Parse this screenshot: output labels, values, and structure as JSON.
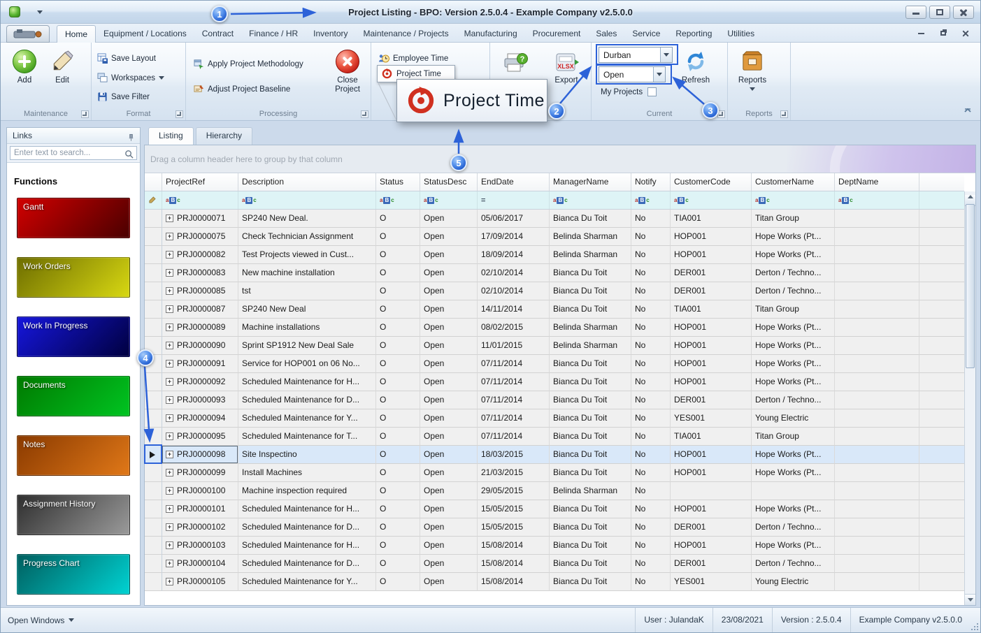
{
  "window": {
    "title": "Project Listing - BPO: Version 2.5.0.4 - Example Company v2.5.0.0"
  },
  "colors": {
    "annotation_blue": "#2d62d8",
    "selected_row": "#d9e8f9",
    "filter_row": "#def4f6"
  },
  "icons": [
    "app-logo-icon",
    "quick-access-dropdown-icon",
    "minimize-icon",
    "maximize-icon",
    "close-icon",
    "add-icon",
    "edit-icon",
    "save-layout-icon",
    "workspaces-icon",
    "save-filter-icon",
    "apply-methodology-icon",
    "adjust-baseline-icon",
    "close-project-icon",
    "employee-time-icon",
    "project-time-icon",
    "print-icon",
    "export-icon",
    "refresh-icon",
    "reports-icon",
    "pin-icon",
    "search-icon",
    "expand-icon",
    "row-marker-icon",
    "filter-abc-icon",
    "filter-equals-icon"
  ],
  "ribbon": {
    "tabs": [
      "Home",
      "Equipment / Locations",
      "Contract",
      "Finance / HR",
      "Inventory",
      "Maintenance / Projects",
      "Manufacturing",
      "Procurement",
      "Sales",
      "Service",
      "Reporting",
      "Utilities"
    ],
    "active_tab": "Home",
    "maintenance": {
      "label": "Maintenance",
      "add": "Add",
      "edit": "Edit"
    },
    "format": {
      "label": "Format",
      "save_layout": "Save Layout",
      "workspaces": "Workspaces",
      "save_filter": "Save Filter"
    },
    "processing": {
      "label": "Processing",
      "apply": "Apply Project Methodology",
      "adjust": "Adjust Project Baseline",
      "close_project": "Close Project"
    },
    "time": {
      "employee_time": "Employee Time",
      "project_time": "Project Time"
    },
    "export_label": "Export",
    "current": {
      "label": "Current",
      "site_value": "Durban",
      "status_value": "Open",
      "my_projects": "My Projects",
      "refresh": "Refresh"
    },
    "reports": {
      "label": "Reports",
      "button": "Reports"
    },
    "callout_text": "Project Time"
  },
  "sidebar": {
    "title": "Links",
    "search_placeholder": "Enter text to search...",
    "functions_header": "Functions",
    "functions": [
      {
        "label": "Gantt",
        "color_from": "#d10000",
        "color_to": "#4a0000"
      },
      {
        "label": "Work Orders",
        "color_from": "#6e6e00",
        "color_to": "#d8d812"
      },
      {
        "label": "Work In Progress",
        "color_from": "#1616dc",
        "color_to": "#00003f"
      },
      {
        "label": "Documents",
        "color_from": "#007a00",
        "color_to": "#00c421"
      },
      {
        "label": "Notes",
        "color_from": "#8a3a00",
        "color_to": "#e07818"
      },
      {
        "label": "Assignment History",
        "color_from": "#2f2f2f",
        "color_to": "#9a9a9a"
      },
      {
        "label": "Progress Chart",
        "color_from": "#005f5f",
        "color_to": "#00d2d2"
      }
    ]
  },
  "main": {
    "tabs": [
      "Listing",
      "Hierarchy"
    ],
    "active_tab": "Listing",
    "group_by_hint": "Drag a column header here to group by that column",
    "grid": {
      "columns": [
        "ProjectRef",
        "Description",
        "Status",
        "StatusDesc",
        "EndDate",
        "ManagerName",
        "Notify",
        "CustomerCode",
        "CustomerName",
        "DeptName"
      ],
      "filter_badge": "aBc",
      "filter_equals": "=",
      "expand_glyph": "+",
      "selected_index": 13,
      "rows": [
        [
          "PRJ0000071",
          "SP240 New Deal.",
          "O",
          "Open",
          "05/06/2017",
          "Bianca Du Toit",
          "No",
          "TIA001",
          "Titan Group",
          ""
        ],
        [
          "PRJ0000075",
          "Check Technician Assignment",
          "O",
          "Open",
          "17/09/2014",
          "Belinda Sharman",
          "No",
          "HOP001",
          "Hope Works (Pt...",
          ""
        ],
        [
          "PRJ0000082",
          "Test Projects viewed in Cust...",
          "O",
          "Open",
          "18/09/2014",
          "Belinda Sharman",
          "No",
          "HOP001",
          "Hope Works (Pt...",
          ""
        ],
        [
          "PRJ0000083",
          "New machine installation",
          "O",
          "Open",
          "02/10/2014",
          "Bianca Du Toit",
          "No",
          "DER001",
          "Derton / Techno...",
          ""
        ],
        [
          "PRJ0000085",
          "tst",
          "O",
          "Open",
          "02/10/2014",
          "Bianca Du Toit",
          "No",
          "DER001",
          "Derton / Techno...",
          ""
        ],
        [
          "PRJ0000087",
          "SP240 New Deal",
          "O",
          "Open",
          "14/11/2014",
          "Bianca Du Toit",
          "No",
          "TIA001",
          "Titan Group",
          ""
        ],
        [
          "PRJ0000089",
          "Machine installations",
          "O",
          "Open",
          "08/02/2015",
          "Belinda Sharman",
          "No",
          "HOP001",
          "Hope Works (Pt...",
          ""
        ],
        [
          "PRJ0000090",
          "Sprint SP1912 New Deal Sale",
          "O",
          "Open",
          "11/01/2015",
          "Belinda Sharman",
          "No",
          "HOP001",
          "Hope Works (Pt...",
          ""
        ],
        [
          "PRJ0000091",
          "Service for HOP001 on 06 No...",
          "O",
          "Open",
          "07/11/2014",
          "Bianca Du Toit",
          "No",
          "HOP001",
          "Hope Works (Pt...",
          ""
        ],
        [
          "PRJ0000092",
          "Scheduled Maintenance for H...",
          "O",
          "Open",
          "07/11/2014",
          "Bianca Du Toit",
          "No",
          "HOP001",
          "Hope Works (Pt...",
          ""
        ],
        [
          "PRJ0000093",
          "Scheduled Maintenance for D...",
          "O",
          "Open",
          "07/11/2014",
          "Bianca Du Toit",
          "No",
          "DER001",
          "Derton / Techno...",
          ""
        ],
        [
          "PRJ0000094",
          "Scheduled Maintenance for Y...",
          "O",
          "Open",
          "07/11/2014",
          "Bianca Du Toit",
          "No",
          "YES001",
          "Young Electric",
          ""
        ],
        [
          "PRJ0000095",
          "Scheduled Maintenance for T...",
          "O",
          "Open",
          "07/11/2014",
          "Bianca Du Toit",
          "No",
          "TIA001",
          "Titan Group",
          ""
        ],
        [
          "PRJ0000098",
          "Site Inspectino",
          "O",
          "Open",
          "18/03/2015",
          "Bianca Du Toit",
          "No",
          "HOP001",
          "Hope Works (Pt...",
          ""
        ],
        [
          "PRJ0000099",
          "Install Machines",
          "O",
          "Open",
          "21/03/2015",
          "Bianca Du Toit",
          "No",
          "HOP001",
          "Hope Works (Pt...",
          ""
        ],
        [
          "PRJ0000100",
          "Machine inspection required",
          "O",
          "Open",
          "29/05/2015",
          "Belinda Sharman",
          "No",
          "",
          "",
          ""
        ],
        [
          "PRJ0000101",
          "Scheduled Maintenance for H...",
          "O",
          "Open",
          "15/05/2015",
          "Bianca Du Toit",
          "No",
          "HOP001",
          "Hope Works (Pt...",
          ""
        ],
        [
          "PRJ0000102",
          "Scheduled Maintenance for D...",
          "O",
          "Open",
          "15/05/2015",
          "Bianca Du Toit",
          "No",
          "DER001",
          "Derton / Techno...",
          ""
        ],
        [
          "PRJ0000103",
          "Scheduled Maintenance for H...",
          "O",
          "Open",
          "15/08/2014",
          "Bianca Du Toit",
          "No",
          "HOP001",
          "Hope Works (Pt...",
          ""
        ],
        [
          "PRJ0000104",
          "Scheduled Maintenance for D...",
          "O",
          "Open",
          "15/08/2014",
          "Bianca Du Toit",
          "No",
          "DER001",
          "Derton / Techno...",
          ""
        ],
        [
          "PRJ0000105",
          "Scheduled Maintenance for Y...",
          "O",
          "Open",
          "15/08/2014",
          "Bianca Du Toit",
          "No",
          "YES001",
          "Young Electric",
          ""
        ]
      ]
    }
  },
  "statusbar": {
    "open_windows": "Open Windows",
    "segments": [
      "User : JulandaK",
      "23/08/2021",
      "Version : 2.5.0.4",
      "Example Company v2.5.0.0"
    ]
  },
  "annotations": {
    "balloons": [
      "1",
      "2",
      "3",
      "4",
      "5"
    ]
  }
}
